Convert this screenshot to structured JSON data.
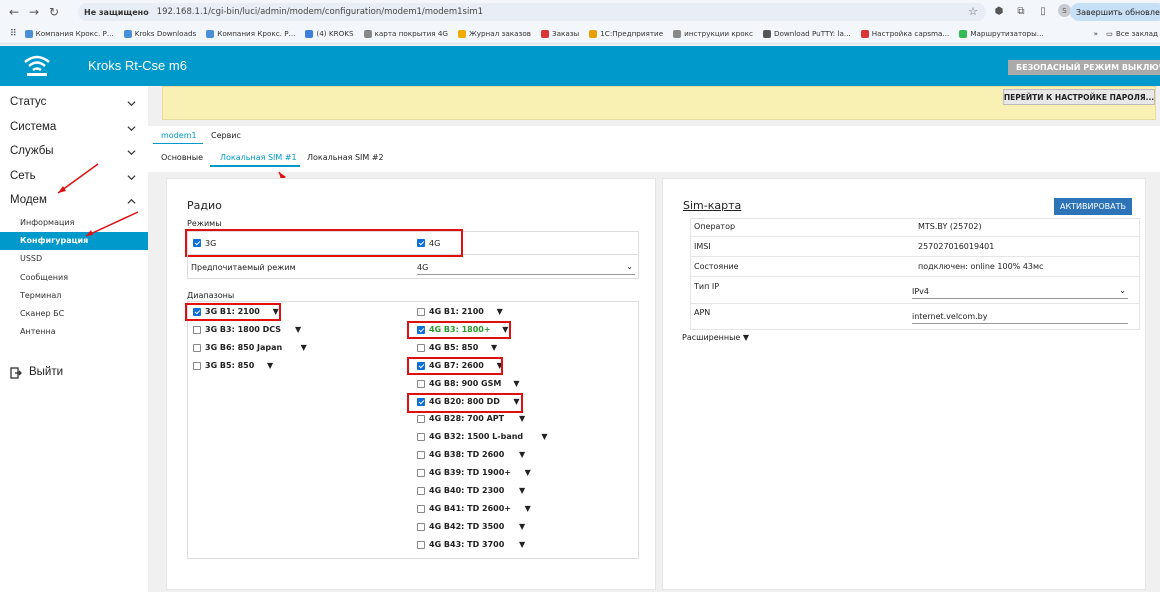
{
  "browser": {
    "insecure": "Не защищено",
    "url": "192.168.1.1/cgi-bin/luci/admin/modem/configuration/modem1/modem1sim1",
    "update": "Завершить обновление",
    "profile": "S"
  },
  "bookmarks": [
    "Компания Крокс. Р...",
    "Kroks Downloads",
    "Компания Крокс. Р...",
    "(4) KROKS",
    "карта покрытия 4G",
    "Журнал заказов",
    "Заказы",
    "1С:Предприятие",
    "инструкции крокс",
    "Download PuTTY: la...",
    "Настройка capsma...",
    "Маршрутизаторы..."
  ],
  "bookmarks_right": "Все заклад",
  "header": {
    "title": "Kroks Rt-Cse m6",
    "safe_mode": "БЕЗОПАСНЫЙ РЕЖИМ ВЫКЛЮЧЕН"
  },
  "sidebar": {
    "items": [
      "Статус",
      "Система",
      "Службы",
      "Сеть",
      "Модем"
    ],
    "modem_sub": [
      "Информация",
      "Конфигурация",
      "USSD",
      "Сообщения",
      "Терминал",
      "Сканер БС",
      "Антенна"
    ],
    "logout": "Выйти"
  },
  "main": {
    "password_button": "ПЕРЕЙТИ К НАСТРОЙКЕ ПАРОЛЯ...",
    "tabs_top": [
      "modem1",
      "Сервис"
    ],
    "tabs_sub": [
      "Основные",
      "Локальная SIM #1",
      "Локальная SIM #2"
    ]
  },
  "radio": {
    "title": "Радио",
    "modes_label": "Режимы",
    "mode_3g": "3G",
    "mode_4g": "4G",
    "pref_label": "Предпочитаемый режим",
    "pref_value": "4G",
    "bands_label": "Диапазоны",
    "bands_3g": [
      {
        "label": "3G B1: 2100",
        "checked": true
      },
      {
        "label": "3G B3: 1800 DCS",
        "checked": false
      },
      {
        "label": "3G B6: 850 Japan",
        "checked": false
      },
      {
        "label": "3G B5: 850",
        "checked": false
      }
    ],
    "bands_4g": [
      {
        "label": "4G B1: 2100",
        "checked": false
      },
      {
        "label": "4G B3: 1800+",
        "checked": true
      },
      {
        "label": "4G B5: 850",
        "checked": false
      },
      {
        "label": "4G B7: 2600",
        "checked": true
      },
      {
        "label": "4G B8: 900 GSM",
        "checked": false
      },
      {
        "label": "4G B20: 800 DD",
        "checked": true
      },
      {
        "label": "4G B28: 700 APT",
        "checked": false
      },
      {
        "label": "4G B32: 1500 L-band",
        "checked": false
      },
      {
        "label": "4G B38: TD 2600",
        "checked": false
      },
      {
        "label": "4G B39: TD 1900+",
        "checked": false
      },
      {
        "label": "4G B40: TD 2300",
        "checked": false
      },
      {
        "label": "4G B41: TD 2600+",
        "checked": false
      },
      {
        "label": "4G B42: TD 3500",
        "checked": false
      },
      {
        "label": "4G B43: TD 3700",
        "checked": false
      }
    ]
  },
  "sim": {
    "title": "Sim-карта",
    "activate": "АКТИВИРОВАТЬ",
    "operator_k": "Оператор",
    "operator_v": "MTS.BY (25702)",
    "imsi_k": "IMSI",
    "imsi_v": "257027016019401",
    "state_k": "Состояние",
    "state_v": "подключен: online 100% 43мс",
    "iptype_k": "Тип IP",
    "iptype_v": "IPv4",
    "apn_k": "APN",
    "apn_v": "internet.velcom.by",
    "advanced": "Расширенные ▼"
  },
  "colors": {
    "accent": "#0099cc",
    "highlight": "#e01010",
    "green_band": "#2a9a2a"
  }
}
